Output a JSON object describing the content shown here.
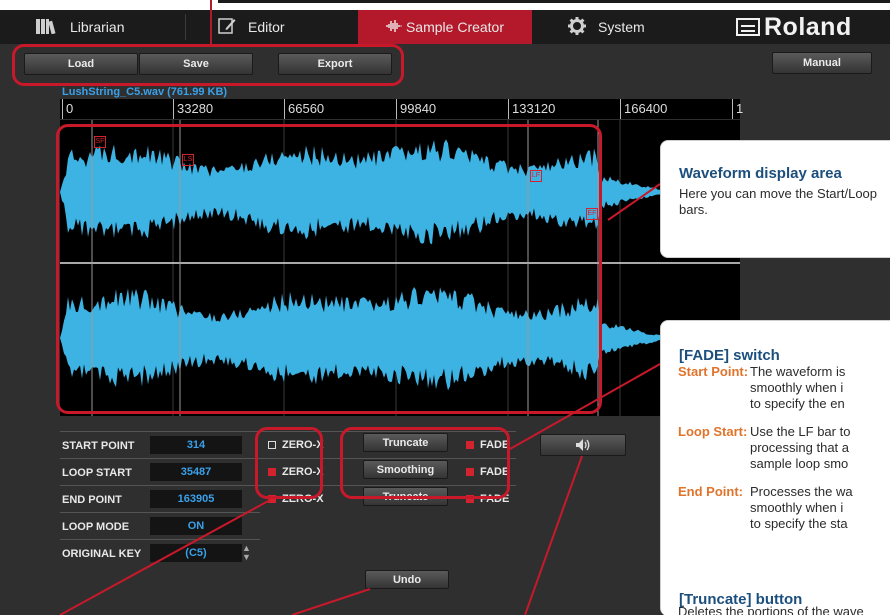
{
  "tabs": [
    {
      "label": "Librarian",
      "icon": "books-icon"
    },
    {
      "label": "Editor",
      "icon": "edit-icon"
    },
    {
      "label": "Sample Creator",
      "icon": "waveform-icon"
    },
    {
      "label": "System",
      "icon": "gear-icon"
    }
  ],
  "brand": "Roland",
  "toolbar": {
    "load": "Load",
    "save": "Save",
    "export": "Export",
    "manual": "Manual"
  },
  "file": {
    "name": "LushString_C5.wav (761.99 KB)"
  },
  "ruler": {
    "ticks": [
      "0",
      "33280",
      "66560",
      "99840",
      "133120",
      "166400",
      "1"
    ]
  },
  "markers": {
    "sf": "SF",
    "ls": "LS",
    "lf": "LF",
    "ef": "EF"
  },
  "params": [
    {
      "label": "START POINT",
      "value": "314"
    },
    {
      "label": "LOOP START",
      "value": "35487"
    },
    {
      "label": "END POINT",
      "value": "163905"
    },
    {
      "label": "LOOP MODE",
      "value": "ON"
    },
    {
      "label": "ORIGINAL KEY",
      "value": "(C5)"
    }
  ],
  "zero_cross": {
    "label": "ZERO-X",
    "states": [
      false,
      true,
      true
    ]
  },
  "process_buttons": [
    "Truncate",
    "Smoothing",
    "Truncate"
  ],
  "fade": {
    "label": "FADE",
    "states": [
      true,
      true,
      true
    ]
  },
  "undo": "Undo",
  "callouts": {
    "waveform": {
      "title": "Waveform display area",
      "text": "Here you can move the Start/Loop",
      "text2": "bars."
    },
    "fade": {
      "title": "[FADE] switch",
      "items": [
        {
          "term": "Start Point:",
          "lines": [
            "The waveform is",
            "smoothly when i",
            "to specify the en"
          ]
        },
        {
          "term": "Loop Start:",
          "lines": [
            "Use the LF bar to",
            "processing that a",
            "sample loop smo"
          ]
        },
        {
          "term": "End Point:",
          "lines": [
            "Processes the wa",
            "smoothly when i",
            "to specify the sta"
          ]
        }
      ]
    },
    "truncate": {
      "title": "[Truncate] button",
      "text": "Deletes the portions of the wave"
    }
  }
}
